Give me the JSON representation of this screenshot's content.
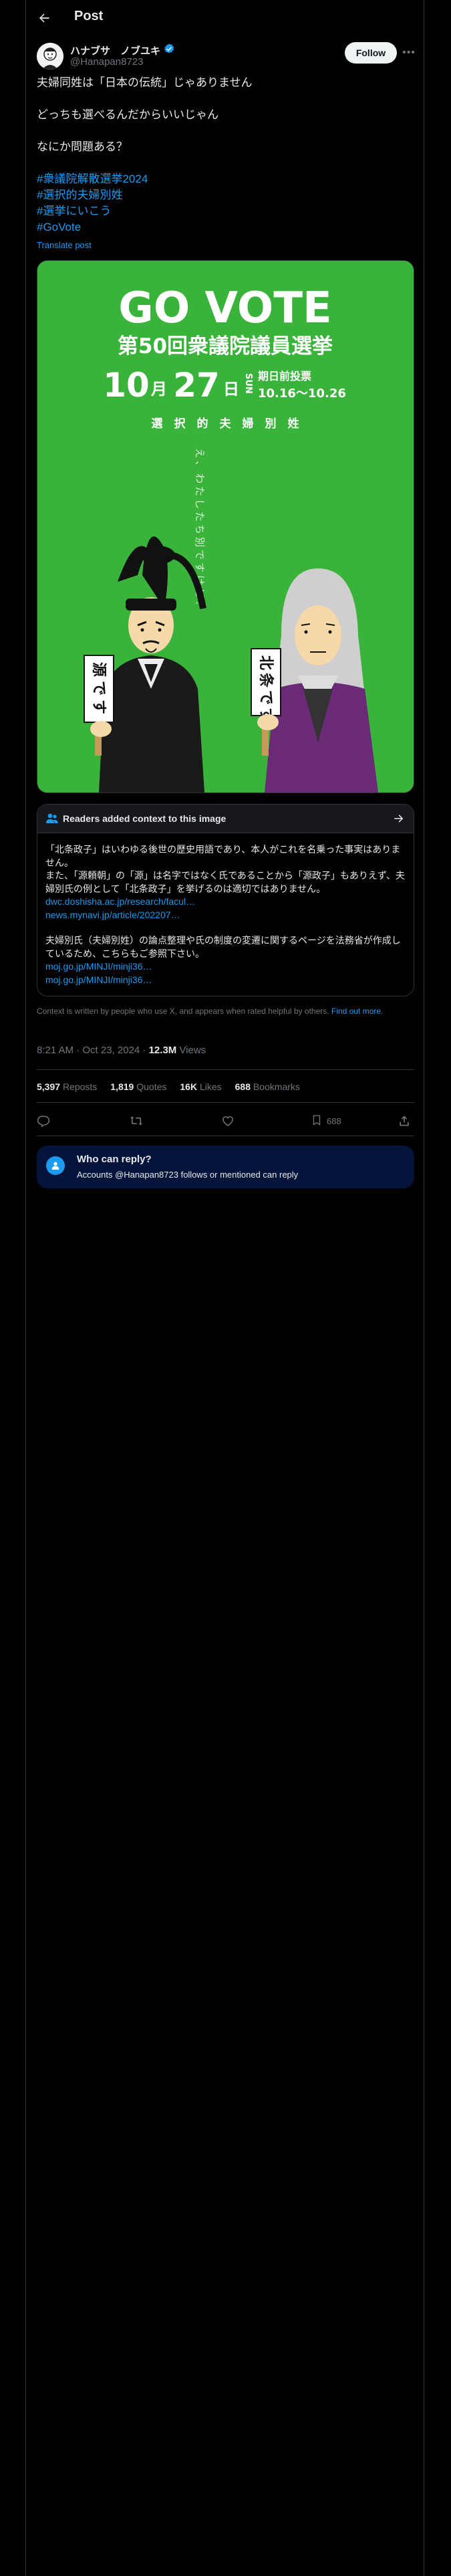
{
  "header": {
    "title": "Post"
  },
  "author": {
    "display_name": "ハナブサ　ノブユキ",
    "handle": "@Hanapan8723"
  },
  "follow_label": "Follow",
  "post": {
    "lines": [
      "夫婦同姓は「日本の伝統」じゃありません",
      "",
      "どっちも選べるんだからいいじゃん",
      "",
      "なにか問題ある？",
      ""
    ],
    "hashtags": [
      "#衆議院解散選挙2024",
      "#選択的夫婦別姓",
      "#選挙にいこう",
      "#GoVote"
    ],
    "translate": "Translate post"
  },
  "poster": {
    "headline": "GO VOTE",
    "election": "第50回衆議院議員選挙",
    "date_month": "10",
    "date_month_unit": "月",
    "date_day": "27",
    "date_day_unit": "日",
    "weekday": "SUN",
    "early_vote_label": "期日前投票",
    "early_vote_range": "10.16〜10.26",
    "slogan": "選　択　的　夫　婦　別　姓",
    "speech": "え、わたしたち別ですけど？",
    "sign_left": "源です",
    "sign_right": "北条です"
  },
  "community_note": {
    "title": "Readers added context to this image",
    "paragraphs": [
      "「北条政子」はいわゆる後世の歴史用語であり、本人がこれを名乗った事実はありません。",
      "また、「源頼朝」の「源」は名字ではなく氏であることから「源政子」もありえず、夫婦別氏の例として「北条政子」を挙げるのは適切ではありません。"
    ],
    "links_1": [
      "dwc.doshisha.ac.jp/research/facul…",
      "news.mynavi.jp/article/202207…"
    ],
    "paragraph_2": "夫婦別氏（夫婦別姓）の論点整理や氏の制度の変遷に関するページを法務省が作成しているため、こちらもご参照下さい。",
    "links_2": [
      "moj.go.jp/MINJI/minji36…",
      "moj.go.jp/MINJI/minji36…"
    ]
  },
  "context_footer": {
    "text": "Context is written by people who use X, and appears when rated helpful by others.",
    "link": "Find out more."
  },
  "meta": {
    "time": "8:21 AM · Oct 23, 2024 · ",
    "views_count": "12.3M",
    "views_label": " Views"
  },
  "stats": {
    "reposts_count": "5,397",
    "reposts_label": "Reposts",
    "quotes_count": "1,819",
    "quotes_label": "Quotes",
    "likes_count": "16K",
    "likes_label": "Likes",
    "bookmarks_count": "688",
    "bookmarks_label": "Bookmarks"
  },
  "actions": {
    "bookmark_count": "688"
  },
  "reply_prompt": {
    "title": "Who can reply?",
    "subtitle": "Accounts @Hanapan8723 follows or mentioned can reply"
  },
  "colors": {
    "poster_green": "#39b33a",
    "link_blue": "#1d9bf0",
    "reply_box_bg": "#05143a"
  }
}
